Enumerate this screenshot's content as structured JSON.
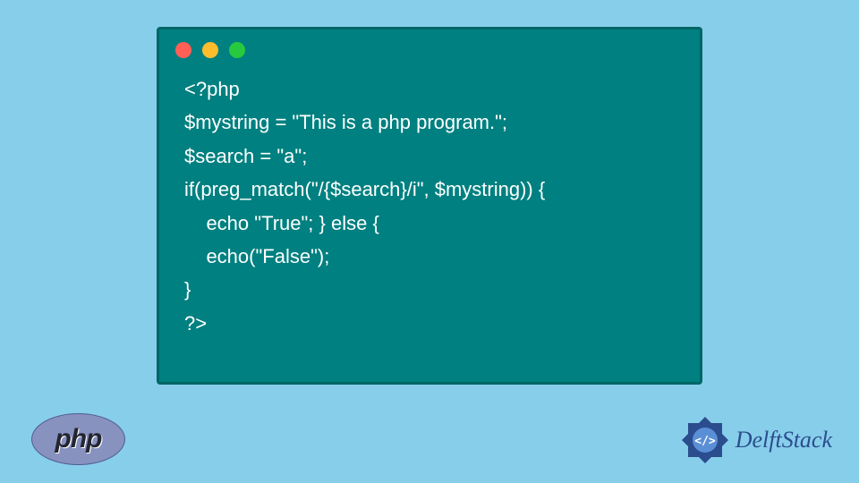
{
  "code": {
    "lines": [
      "<?php",
      "$mystring = \"This is a php program.\";",
      "$search = \"a\";",
      "if(preg_match(\"/{$search}/i\", $mystring)) {",
      "    echo \"True\"; } else {",
      "    echo(\"False\");",
      "}",
      "?>"
    ]
  },
  "logos": {
    "php": "php",
    "delft": "DelftStack"
  },
  "colors": {
    "background": "#87ceeb",
    "codebg": "#008080",
    "php_purple": "#8892bf",
    "delft_blue": "#2b4d8e"
  }
}
